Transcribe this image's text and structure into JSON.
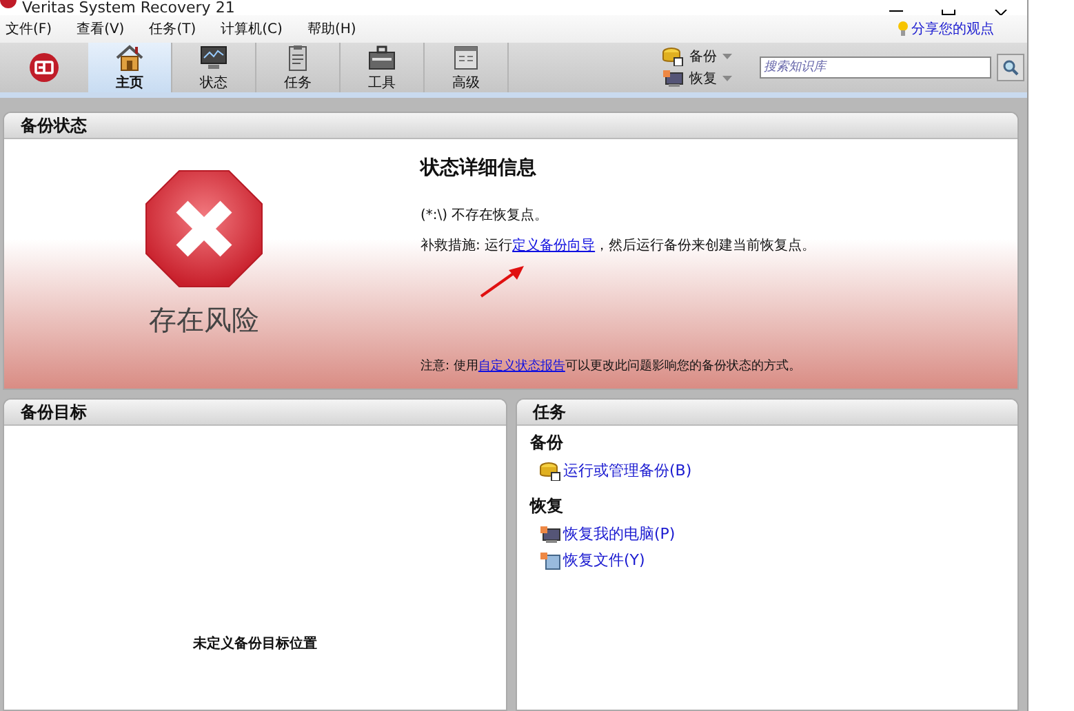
{
  "window": {
    "title": "Veritas System Recovery 21"
  },
  "menu": [
    {
      "label": "文件(F)"
    },
    {
      "label": "查看(V)"
    },
    {
      "label": "任务(T)"
    },
    {
      "label": "计算机(C)"
    },
    {
      "label": "帮助(H)"
    }
  ],
  "feedback_link": "分享您的观点",
  "nav_tabs": [
    {
      "label": "主页",
      "selected": true,
      "kind": "home"
    },
    {
      "label": "状态",
      "selected": false,
      "kind": "monitor"
    },
    {
      "label": "任务",
      "selected": false,
      "kind": "clipboard"
    },
    {
      "label": "工具",
      "selected": false,
      "kind": "toolbox"
    },
    {
      "label": "高级",
      "selected": false,
      "kind": "window"
    }
  ],
  "quick_actions": [
    {
      "label": "备份",
      "kind": "backup"
    },
    {
      "label": "恢复",
      "kind": "recover"
    }
  ],
  "search": {
    "placeholder": "搜索知识库"
  },
  "status_panel": {
    "title": "备份状态",
    "status": "存在风险",
    "heading": "状态详细信息",
    "detail": "(*:\\) 不存在恢复点。",
    "remedy": {
      "before": "补救措施: 运行",
      "link": "定义备份向导",
      "after": "，然后运行备份来创建当前恢复点。"
    },
    "note": {
      "before": "注意: 使用",
      "link": "自定义状态报告",
      "after": "可以更改此问题影响您的备份状态的方式。"
    }
  },
  "destinations_panel": {
    "title": "备份目标",
    "empty_message": "未定义备份目标位置"
  },
  "tasks_panel": {
    "title": "任务",
    "groups": [
      {
        "heading": "备份",
        "items": [
          {
            "label": "运行或管理备份(B)",
            "kind": "backup"
          }
        ]
      },
      {
        "heading": "恢复",
        "items": [
          {
            "label": "恢复我的电脑(P)",
            "kind": "computer"
          },
          {
            "label": "恢复文件(Y)",
            "kind": "files"
          }
        ]
      }
    ]
  }
}
